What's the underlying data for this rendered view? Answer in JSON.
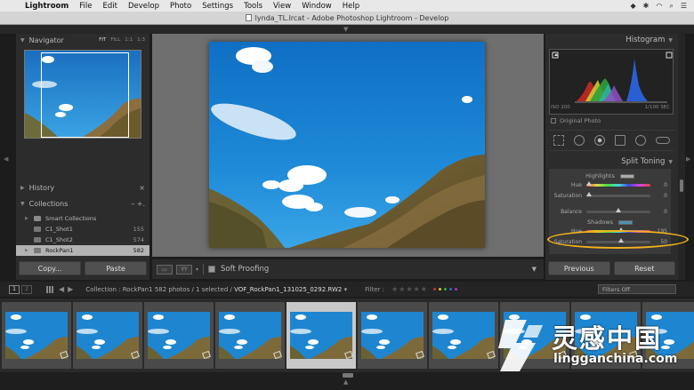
{
  "menubar": {
    "apple_icon": "apple-icon",
    "app_name": "Lightroom",
    "items": [
      "File",
      "Edit",
      "Develop",
      "Photo",
      "Settings",
      "Tools",
      "View",
      "Window",
      "Help"
    ]
  },
  "titlebar": {
    "title": "lynda_TL.lrcat - Adobe Photoshop Lightroom - Develop"
  },
  "navigator": {
    "title": "Navigator",
    "zoom_options": [
      "FIT",
      "FILL",
      "1:1",
      "1:3"
    ],
    "active_zoom": "FIT"
  },
  "history": {
    "title": "History",
    "close": "×"
  },
  "collections": {
    "title": "Collections",
    "actions": "– +.",
    "items": [
      {
        "name": "Smart Collections",
        "count": "",
        "kind": "set"
      },
      {
        "name": "C1_Shot1",
        "count": "155",
        "kind": "collection"
      },
      {
        "name": "C1_Shot2",
        "count": "574",
        "kind": "collection"
      },
      {
        "name": "RockPan1",
        "count": "582",
        "kind": "collection",
        "selected": true
      }
    ]
  },
  "left_buttons": {
    "copy": "Copy...",
    "paste": "Paste"
  },
  "toolbar": {
    "view_label": "YY",
    "soft_proofing": "Soft Proofing",
    "menu_arrow": "▼"
  },
  "histogram": {
    "title": "Histogram",
    "iso": "ISO 200",
    "shutter": "1/100 SEC",
    "original_photo": "Original Photo"
  },
  "split_toning": {
    "title": "Split Toning",
    "highlights": {
      "title": "Highlights",
      "hue_label": "Hue",
      "hue_value": "0",
      "sat_label": "Saturation",
      "sat_value": "0"
    },
    "balance": {
      "label": "Balance",
      "value": "0"
    },
    "shadows": {
      "title": "Shadows",
      "hue_label": "Hue",
      "hue_value": "195",
      "sat_label": "Saturation",
      "sat_value": "50"
    }
  },
  "right_buttons": {
    "previous": "Previous",
    "reset": "Reset"
  },
  "filmbar": {
    "view1": "1",
    "view2": "2",
    "collection": "Collection : RockPan1",
    "info": "582 photos / 1 selected /",
    "filename": "VOF_RockPan1_131025_0292.RW2",
    "filter_label": "Filter :",
    "filter_value": "Filters Off",
    "stars": "★★★★★"
  },
  "watermark": {
    "cn": "灵感中国",
    "en": "lingganchina.com"
  },
  "colors": {
    "sky": "#1e86d0",
    "hill": "#7c6a3a",
    "accent_ring": "#f2b21c",
    "panel": "#2c2c2c"
  }
}
